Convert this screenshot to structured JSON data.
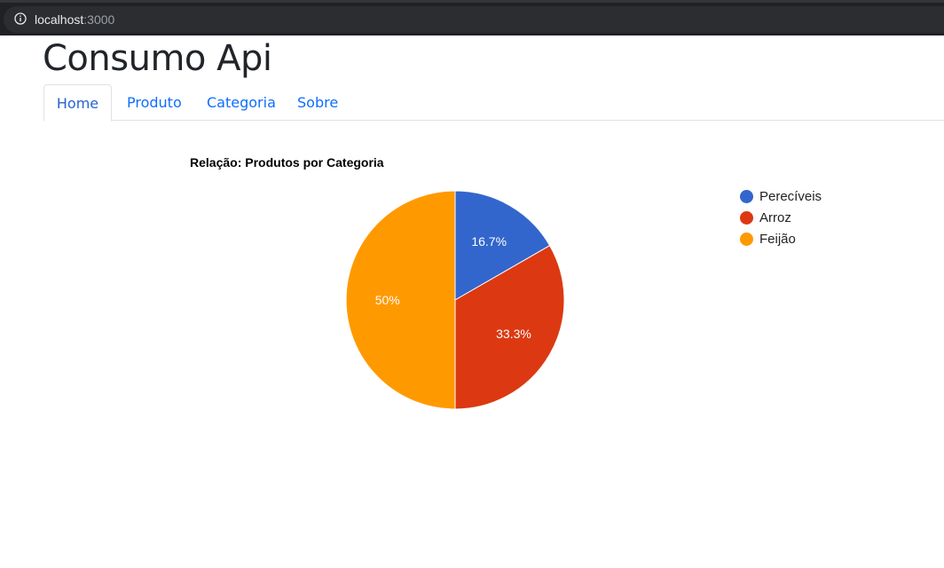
{
  "browser": {
    "url_host": "localhost",
    "url_port": ":3000"
  },
  "page": {
    "title": "Consumo Api"
  },
  "nav": {
    "tabs": [
      {
        "label": "Home",
        "active": true
      },
      {
        "label": "Produto",
        "active": false
      },
      {
        "label": "Categoria",
        "active": false
      },
      {
        "label": "Sobre",
        "active": false
      }
    ]
  },
  "chart_data": {
    "type": "pie",
    "title": "Relação: Produtos por Categoria",
    "legend_position": "right",
    "slices": [
      {
        "label": "Perecíveis",
        "value": 16.7,
        "display": "16.7%",
        "color": "#3366cc"
      },
      {
        "label": "Arroz",
        "value": 33.3,
        "display": "33.3%",
        "color": "#dc3912"
      },
      {
        "label": "Feijão",
        "value": 50,
        "display": "50%",
        "color": "#ff9900"
      }
    ]
  }
}
